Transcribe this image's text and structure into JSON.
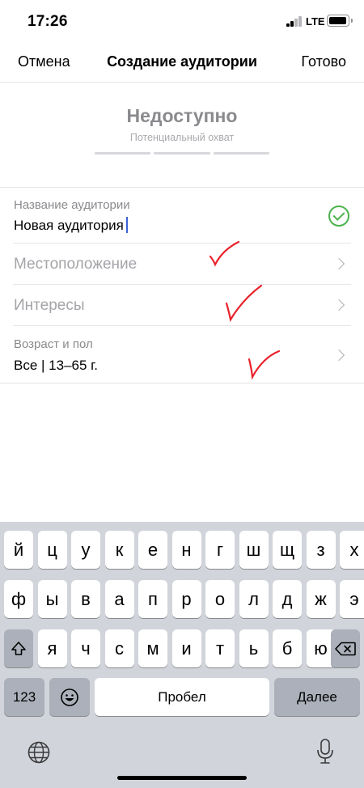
{
  "status_bar": {
    "time": "17:26",
    "network": "LTE"
  },
  "nav": {
    "cancel": "Отмена",
    "title": "Создание аудитории",
    "done": "Готово"
  },
  "reach": {
    "value": "Недоступно",
    "caption": "Потенциальный охват"
  },
  "form": {
    "name_caption": "Название аудитории",
    "name_value": "Новая аудитория",
    "location_placeholder": "Местоположение",
    "interests_placeholder": "Интересы",
    "age_caption": "Возраст и пол",
    "age_value": "Все | 13–65 г."
  },
  "keyboard": {
    "row1": [
      "й",
      "ц",
      "у",
      "к",
      "е",
      "н",
      "г",
      "ш",
      "щ",
      "з",
      "х"
    ],
    "row2": [
      "ф",
      "ы",
      "в",
      "а",
      "п",
      "р",
      "о",
      "л",
      "д",
      "ж",
      "э"
    ],
    "row3": [
      "я",
      "ч",
      "с",
      "м",
      "и",
      "т",
      "ь",
      "б",
      "ю"
    ],
    "numbers_key": "123",
    "space_key": "Пробел",
    "return_key": "Далее"
  },
  "colors": {
    "accent_check": "#4bb34b",
    "annotation": "#e8222b",
    "cursor": "#3b64d4",
    "keyboard_bg": "#d1d4da"
  },
  "icons": [
    "shift-icon",
    "backspace-icon",
    "emoji-icon",
    "globe-icon",
    "microphone-icon",
    "chevron-right-icon",
    "check-circle-icon"
  ]
}
